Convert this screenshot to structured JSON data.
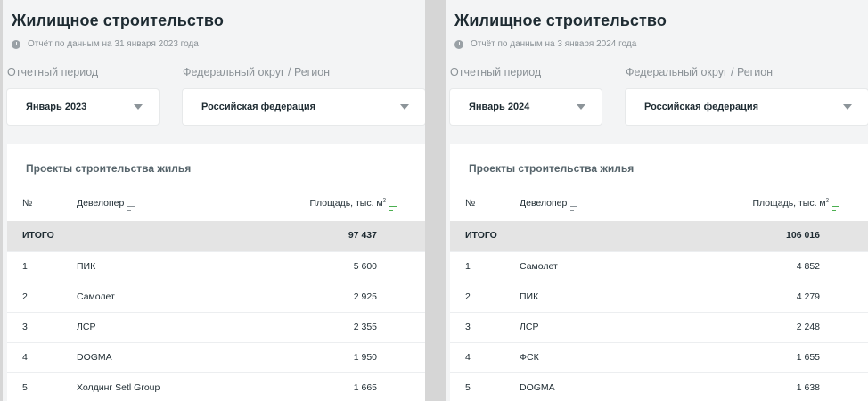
{
  "panels": [
    {
      "title": "Жилищное строительство",
      "report_note": "Отчёт по данным на 31 января 2023 года",
      "period_label": "Отчетный период",
      "period_value": "Январь 2023",
      "region_label": "Федеральный округ / Регион",
      "region_value": "Российская федерация",
      "table_title": "Проекты строительства жилья",
      "columns": {
        "num": "№",
        "developer": "Девелопер",
        "area": "Площадь, тыс. м",
        "area_sup": "2"
      },
      "total": {
        "label": "ИТОГО",
        "value": "97 437"
      },
      "rows": [
        {
          "num": "1",
          "developer": "ПИК",
          "area": "5 600"
        },
        {
          "num": "2",
          "developer": "Самолет",
          "area": "2 925"
        },
        {
          "num": "3",
          "developer": "ЛСР",
          "area": "2 355"
        },
        {
          "num": "4",
          "developer": "DOGMA",
          "area": "1 950"
        },
        {
          "num": "5",
          "developer": "Холдинг Setl Group",
          "area": "1 665"
        }
      ]
    },
    {
      "title": "Жилищное строительство",
      "report_note": "Отчёт по данным на 3 января 2024 года",
      "period_label": "Отчетный период",
      "period_value": "Январь 2024",
      "region_label": "Федеральный округ / Регион",
      "region_value": "Российская федерация",
      "table_title": "Проекты строительства жилья",
      "columns": {
        "num": "№",
        "developer": "Девелопер",
        "area": "Площадь, тыс. м",
        "area_sup": "2"
      },
      "total": {
        "label": "ИТОГО",
        "value": "106 016"
      },
      "rows": [
        {
          "num": "1",
          "developer": "Самолет",
          "area": "4 852"
        },
        {
          "num": "2",
          "developer": "ПИК",
          "area": "4 279"
        },
        {
          "num": "3",
          "developer": "ЛСР",
          "area": "2 248"
        },
        {
          "num": "4",
          "developer": "ФСК",
          "area": "1 655"
        },
        {
          "num": "5",
          "developer": "DOGMA",
          "area": "1 638"
        }
      ]
    }
  ],
  "icons": {
    "report": "clock-icon",
    "dropdown": "chevron-down-icon",
    "sort": "sort-filter-icon"
  },
  "colors": {
    "panel_bg": "#f3f4f5",
    "total_row_bg": "#e4e4e4",
    "sort_active": "#4caf50",
    "divider": "#d6d6d6"
  }
}
